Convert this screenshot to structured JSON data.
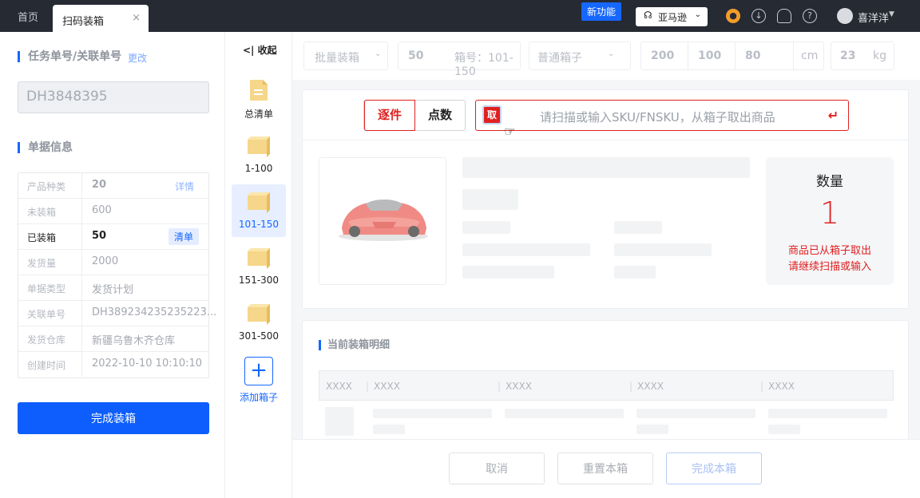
{
  "topbar": {
    "tabs": [
      {
        "label": "首页"
      },
      {
        "label": "扫码装箱",
        "close": "×"
      }
    ],
    "new_feature": "新功能",
    "store": {
      "label": "亚马逊",
      "icon": "store-icon"
    },
    "icons": [
      "support-icon",
      "download-icon",
      "bell-icon",
      "help-icon"
    ],
    "user": {
      "name": "喜洋洋"
    }
  },
  "left": {
    "task_title": "任务单号/关联单号",
    "edit_label": "更改",
    "order_no": "DH3848395",
    "info_title": "单据信息",
    "rows": [
      {
        "key": "产品种类",
        "value": "20",
        "action": "详情"
      },
      {
        "key": "未装箱",
        "value": "600"
      },
      {
        "key": "已装箱",
        "value": "50",
        "action": "清单"
      },
      {
        "key": "发货量",
        "value": "2000"
      },
      {
        "key": "单据类型",
        "value": "发货计划"
      },
      {
        "key": "关联单号",
        "value": "DH389234235235223..."
      },
      {
        "key": "发货仓库",
        "value": "新疆乌鲁木齐仓库"
      },
      {
        "key": "创建时间",
        "value": "2022-10-10 10:10:10"
      }
    ],
    "finish_button": "完成装箱"
  },
  "boxes": {
    "collapse_label": "收起",
    "collapse_icon": "collapse-icon",
    "items": [
      {
        "label": "总清单",
        "icon": "list-icon"
      },
      {
        "label": "1-100",
        "icon": "box-icon"
      },
      {
        "label": "101-150",
        "icon": "box-icon",
        "selected": true
      },
      {
        "label": "151-300",
        "icon": "box-icon"
      },
      {
        "label": "301-500",
        "icon": "box-icon"
      }
    ],
    "add_label": "添加箱子",
    "add_icon": "+"
  },
  "toolbar": {
    "mode": "批量装箱",
    "count": "50",
    "box_range": "箱号：101-150",
    "box_type": "普通箱子",
    "length": "200",
    "width": "100",
    "height": "80",
    "dim_unit": "cm",
    "weight": "23",
    "weight_unit": "kg"
  },
  "scan": {
    "mode_piece": "逐件",
    "mode_count": "点数",
    "take_icon_label": "取",
    "placeholder": "请扫描或输入SKU/FNSKU，从箱子取出商品",
    "quantity_label": "数量",
    "quantity": "1",
    "message_line1": "商品已从箱子取出",
    "message_line2": "请继续扫描或输入"
  },
  "detail": {
    "title": "当前装箱明细",
    "headers": [
      "XXXX",
      "XXXX",
      "XXXX",
      "XXXX",
      "XXXX"
    ]
  },
  "footer": {
    "cancel": "取消",
    "reset": "重置本箱",
    "complete": "完成本箱"
  },
  "colors": {
    "accent": "#1667ff",
    "danger": "#e02020",
    "topbar": "#262a33"
  }
}
